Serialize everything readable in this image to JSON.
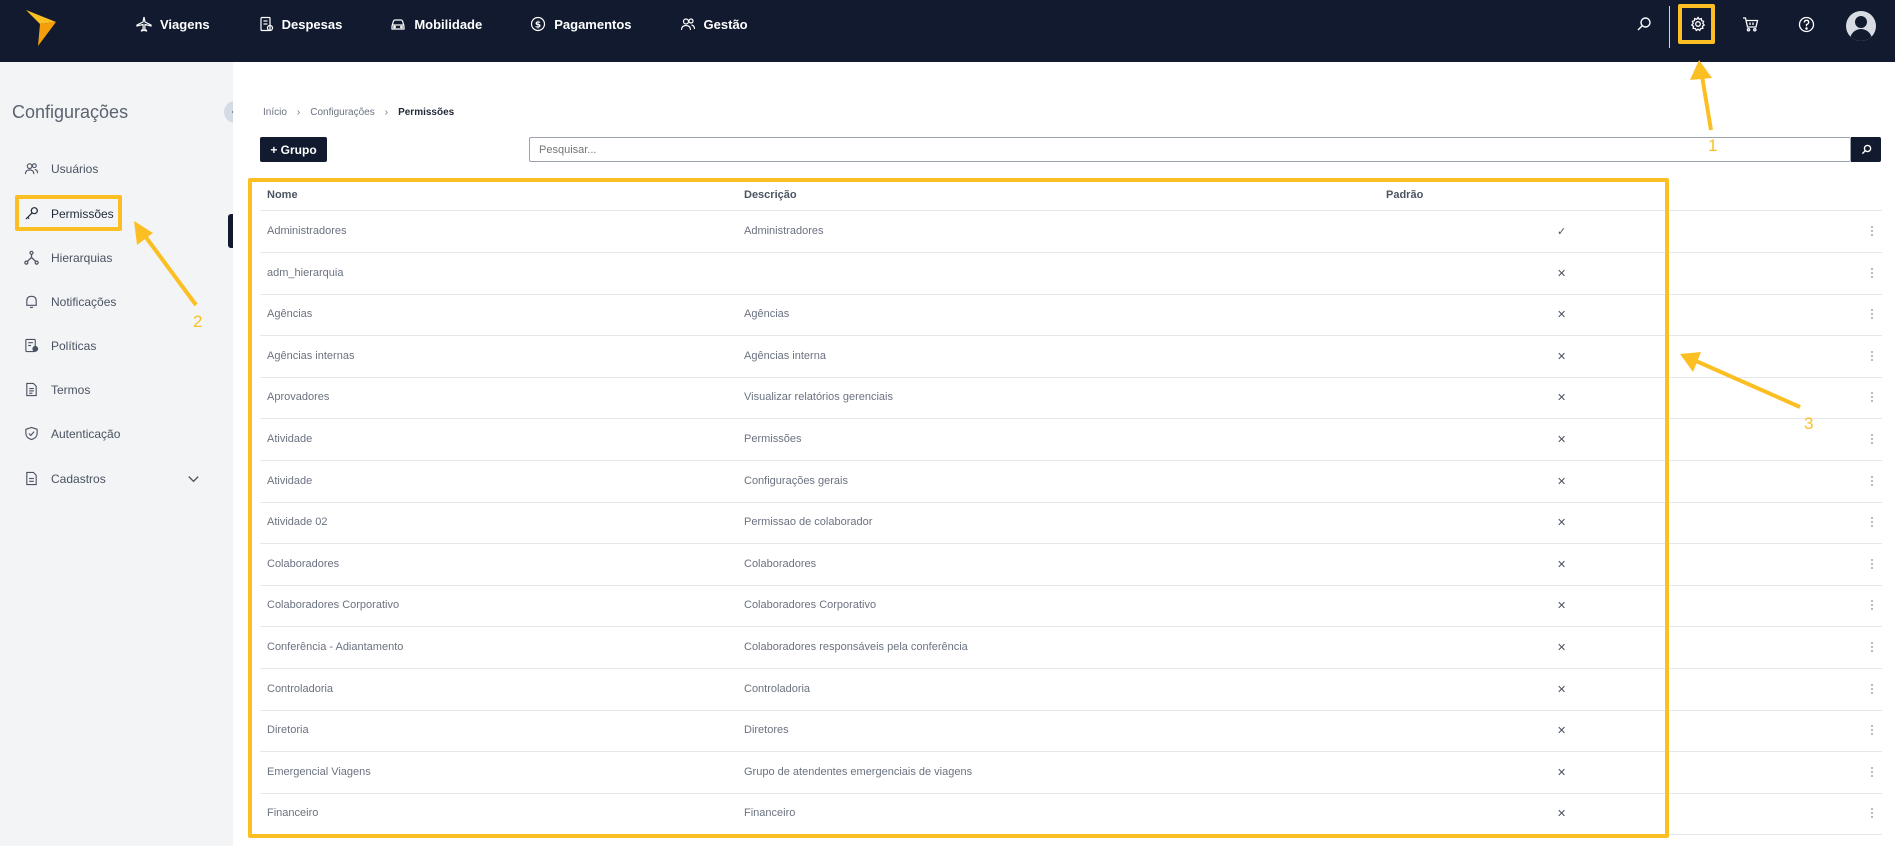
{
  "topnav": {
    "items": [
      {
        "label": "Viagens",
        "icon": "plane-icon"
      },
      {
        "label": "Despesas",
        "icon": "receipt-icon"
      },
      {
        "label": "Mobilidade",
        "icon": "car-icon"
      },
      {
        "label": "Pagamentos",
        "icon": "dollar-icon"
      },
      {
        "label": "Gestão",
        "icon": "users-icon"
      }
    ],
    "icons": [
      "search-icon",
      "gear-icon",
      "cart-icon",
      "help-icon",
      "avatar"
    ]
  },
  "sidebar": {
    "title": "Configurações",
    "items": [
      {
        "label": "Usuários",
        "icon": "users-icon"
      },
      {
        "label": "Permissões",
        "icon": "key-icon"
      },
      {
        "label": "Hierarquias",
        "icon": "hierarchy-icon"
      },
      {
        "label": "Notificações",
        "icon": "bell-icon"
      },
      {
        "label": "Políticas",
        "icon": "policy-icon"
      },
      {
        "label": "Termos",
        "icon": "document-icon"
      },
      {
        "label": "Autenticação",
        "icon": "shield-icon"
      },
      {
        "label": "Cadastros",
        "icon": "file-icon"
      }
    ]
  },
  "breadcrumb": [
    "Início",
    "Configurações",
    "Permissões"
  ],
  "toolbar": {
    "add_group_label": "+ Grupo",
    "search_placeholder": "Pesquisar..."
  },
  "table": {
    "columns": [
      "Nome",
      "Descrição",
      "Padrão"
    ],
    "rows": [
      {
        "name": "Administradores",
        "description": "Administradores",
        "default": "✓"
      },
      {
        "name": "adm_hierarquia",
        "description": "",
        "default": "✕"
      },
      {
        "name": "Agências",
        "description": "Agências",
        "default": "✕"
      },
      {
        "name": "Agências internas",
        "description": "Agências interna",
        "default": "✕"
      },
      {
        "name": "Aprovadores",
        "description": "Visualizar relatórios gerenciais",
        "default": "✕"
      },
      {
        "name": "Atividade",
        "description": "Permissões",
        "default": "✕"
      },
      {
        "name": "Atividade",
        "description": "Configurações gerais",
        "default": "✕"
      },
      {
        "name": "Atividade 02",
        "description": "Permissao de colaborador",
        "default": "✕"
      },
      {
        "name": "Colaboradores",
        "description": "Colaboradores",
        "default": "✕"
      },
      {
        "name": "Colaboradores Corporativo",
        "description": "Colaboradores Corporativo",
        "default": "✕"
      },
      {
        "name": "Conferência - Adiantamento",
        "description": "Colaboradores responsáveis pela conferência",
        "default": "✕"
      },
      {
        "name": "Controladoria",
        "description": "Controladoria",
        "default": "✕"
      },
      {
        "name": "Diretoria",
        "description": "Diretores",
        "default": "✕"
      },
      {
        "name": "Emergencial Viagens",
        "description": "Grupo de atendentes emergenciais de viagens",
        "default": "✕"
      },
      {
        "name": "Financeiro",
        "description": "Financeiro",
        "default": "✕"
      }
    ]
  },
  "annotations": {
    "one": "1",
    "two": "2",
    "three": "3"
  },
  "colors": {
    "brand_dark": "#121a30",
    "highlight": "#fbbf24",
    "logo": "#fbbf24"
  }
}
